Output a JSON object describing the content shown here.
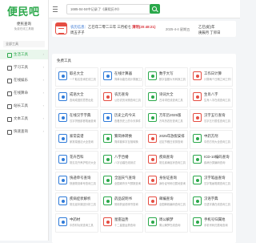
{
  "sidebar": {
    "logo": "便民吧",
    "title": "便民查询",
    "subtitle": "免费在线工具箱",
    "nav_head": "全部工具",
    "items": [
      {
        "label": "生活工具",
        "icon": "home-icon",
        "active": true
      },
      {
        "label": "学习工具",
        "icon": "book-icon",
        "active": false
      },
      {
        "label": "在线娱乐",
        "icon": "game-icon",
        "active": false
      },
      {
        "label": "在线算命",
        "icon": "star-icon",
        "active": false
      },
      {
        "label": "站长工具",
        "icon": "code-icon",
        "active": false
      },
      {
        "label": "文本工具",
        "icon": "text-icon",
        "active": false
      },
      {
        "label": "快速查询",
        "icon": "search-icon",
        "active": false
      }
    ],
    "arrow": "›"
  },
  "topbar": {
    "search_value": "1685-04-04中记录了《康熙历书》"
  },
  "info": {
    "prefix": "农历信息：",
    "ganzhi": "乙巳年二零二三年 三月初七",
    "holiday": "清明(20:48:21)",
    "line2": "农历丁卯年 属兔 羊",
    "line2b": "周五子子",
    "date": "2025-4-4 星期五",
    "tail": "乙巳(蛇)年",
    "tail2": "庚辰月 丁卯日"
  },
  "panel": {
    "title": "免费工具"
  },
  "cards": [
    {
      "title": "取名大全",
      "desc": "一个取名查询在线工具",
      "color": "#2f7bd9"
    },
    {
      "title": "在线计算器",
      "desc": "简单功能在线计算器工具",
      "color": "#2f7bd9"
    },
    {
      "title": "数字大写",
      "desc": "数字金额大写转换工具",
      "color": "#2aa84a"
    },
    {
      "title": "工作日计算",
      "desc": "计算两个日期之间工作日",
      "color": "#e54d42"
    },
    {
      "title": "成语大全",
      "desc": "查询成语的意思出处",
      "color": "#2f7bd9"
    },
    {
      "title": "农历查询",
      "desc": "公历农历对照查询工具",
      "color": "#e54d42"
    },
    {
      "title": "诗词大全",
      "desc": "古诗词在线查询工具",
      "color": "#2aa84a"
    },
    {
      "title": "生肖八字",
      "desc": "生肖八字在线查询工具",
      "color": "#e54d42"
    },
    {
      "title": "在线汉字字典",
      "desc": "汉字拼音部首笔画查询",
      "color": "#2f7bd9"
    },
    {
      "title": "历史上的今天",
      "desc": "查看历史上的今天事件",
      "color": "#2f7bd9"
    },
    {
      "title": "万年历2025版",
      "desc": "万年历农历查询工具",
      "color": "#2aa84a"
    },
    {
      "title": "汉字五行查询",
      "desc": "汉字五行属性查询工具",
      "color": "#e54d42"
    },
    {
      "title": "家常菜谱",
      "desc": "家常菜做法大全查询",
      "color": "#2f7bd9"
    },
    {
      "title": "繁简体转换",
      "desc": "简体繁体字互相转换",
      "color": "#2aa84a"
    },
    {
      "title": "2025年放假安排",
      "desc": "法定节假日安排查询",
      "color": "#e54d42"
    },
    {
      "title": "中药方剂",
      "desc": "中药方剂大全查询工具",
      "color": "#2aa84a"
    },
    {
      "title": "花卉百科",
      "desc": "常见花卉养护知识大全",
      "color": "#2f7bd9"
    },
    {
      "title": "八字合婚",
      "desc": "八字合婚在线测试",
      "color": "#2aa84a"
    },
    {
      "title": "疾病查询",
      "desc": "常见疾病症状查询工具",
      "color": "#e54d42"
    },
    {
      "title": "ICD-10编码查询",
      "desc": "疾病分类编码查询",
      "color": "#2aa84a"
    },
    {
      "title": "快递单号查询",
      "desc": "快递物流单号查询工具",
      "color": "#2f7bd9"
    },
    {
      "title": "全国天气查询",
      "desc": "全国城市天气预报查询",
      "color": "#2aa84a"
    },
    {
      "title": "身份证查询",
      "desc": "身份证号码归属地查询",
      "color": "#e54d42"
    },
    {
      "title": "汉字笔画查询",
      "desc": "汉字笔画笔顺查询工具",
      "color": "#2aa84a"
    },
    {
      "title": "疾病症状解析",
      "desc": "常见症状原因分析工具",
      "color": "#2f7bd9"
    },
    {
      "title": "药品说明书",
      "desc": "常用药品说明书查询",
      "color": "#2aa84a"
    },
    {
      "title": "邮编查询",
      "desc": "全国邮政编码查询工具",
      "color": "#e54d42"
    },
    {
      "title": "汉语字典",
      "desc": "汉语字典在线查询工具",
      "color": "#2aa84a"
    },
    {
      "title": "中药材",
      "desc": "中药材功效查询工具",
      "color": "#2f7bd9"
    },
    {
      "title": "星座运势",
      "desc": "十二星座运势查询",
      "color": "#e54d42"
    },
    {
      "title": "周公解梦",
      "desc": "周公解梦在线查询",
      "color": "#2aa84a"
    },
    {
      "title": "手机号归属地",
      "desc": "手机号码归属地查询",
      "color": "#2aa84a"
    }
  ]
}
